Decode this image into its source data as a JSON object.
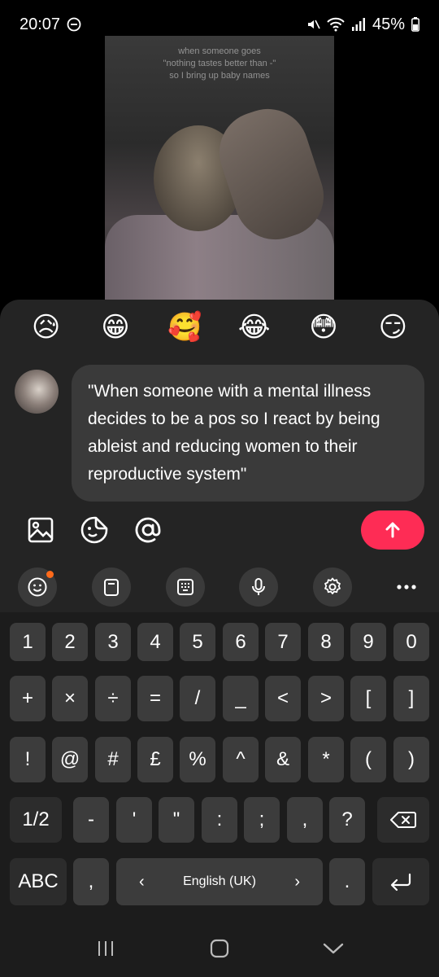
{
  "status_bar": {
    "time": "20:07",
    "battery": "45%"
  },
  "video": {
    "caption": [
      "when someone goes",
      "\"nothing tastes better than -\"",
      "so I bring up baby names"
    ]
  },
  "emoji_reactions": [
    "😥",
    "😁",
    "🥰",
    "😂",
    "😳",
    "😏"
  ],
  "comment": {
    "text": "\"When someone with a mental illness decides to be a pos so I react by being ableist and reducing women to their reproductive system\""
  },
  "toolbar": {
    "send_icon": "arrow-up-icon"
  },
  "keyboard": {
    "row1": [
      "1",
      "2",
      "3",
      "4",
      "5",
      "6",
      "7",
      "8",
      "9",
      "0"
    ],
    "row2": [
      "+",
      "×",
      "÷",
      "=",
      "/",
      "_",
      "<",
      ">",
      "[",
      "]"
    ],
    "row3": [
      "!",
      "@",
      "#",
      "£",
      "%",
      "^",
      "&",
      "*",
      "(",
      ")"
    ],
    "row4_page": "1/2",
    "row4": [
      "-",
      "'",
      "\"",
      ":",
      ";",
      ",",
      "?"
    ],
    "abc": "ABC",
    "comma": ",",
    "space_label": "English (UK)",
    "period": "."
  },
  "colors": {
    "accent": "#fe2c55",
    "sheet": "#242424",
    "key": "#3c3c3c",
    "notification": "#ff6a1a"
  }
}
